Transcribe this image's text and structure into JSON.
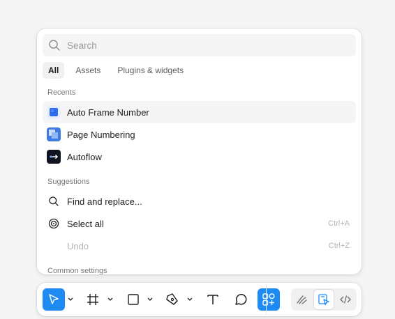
{
  "search": {
    "placeholder": "Search",
    "value": ""
  },
  "tabs": [
    {
      "label": "All",
      "active": true
    },
    {
      "label": "Assets",
      "active": false
    },
    {
      "label": "Plugins & widgets",
      "active": false
    }
  ],
  "recents": {
    "label": "Recents",
    "items": [
      {
        "label": "Auto Frame Number",
        "icon": "auto-frame-number-plugin-icon"
      },
      {
        "label": "Page Numbering",
        "icon": "page-numbering-plugin-icon"
      },
      {
        "label": "Autoflow",
        "icon": "autoflow-plugin-icon"
      }
    ]
  },
  "suggestions": {
    "label": "Suggestions",
    "items": [
      {
        "label": "Find and replace...",
        "icon": "search-icon",
        "shortcut": ""
      },
      {
        "label": "Select all",
        "icon": "target-icon",
        "shortcut": "Ctrl+A"
      },
      {
        "label": "Undo",
        "icon": "",
        "shortcut": "Ctrl+Z",
        "disabled": true
      }
    ]
  },
  "common_settings": {
    "label": "Common settings"
  },
  "toolbar": {
    "tools": [
      "move-tool",
      "frame-tool",
      "shape-tool",
      "pen-tool",
      "text-tool",
      "comment-tool",
      "actions-tool"
    ],
    "modes": [
      "draw-mode",
      "design-mode",
      "dev-mode"
    ],
    "accent": "#1e8bf5"
  }
}
